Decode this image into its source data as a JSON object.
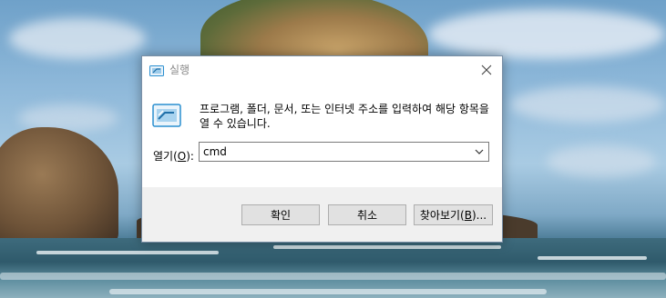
{
  "dialog": {
    "title": "실행",
    "close_icon": "close-icon",
    "description": "프로그램, 폴더, 문서, 또는 인터넷 주소를 입력하여 해당 항목을 열 수 있습니다.",
    "open_label_prefix": "열기(",
    "open_label_key": "O",
    "open_label_suffix": "):",
    "input_value": "cmd",
    "buttons": {
      "ok": "확인",
      "cancel": "취소",
      "browse_prefix": "찾아보기(",
      "browse_key": "B",
      "browse_suffix": ")..."
    }
  },
  "colors": {
    "dialog_bg": "#ffffff",
    "footer_bg": "#f0f0f0",
    "button_bg": "#e1e1e1",
    "icon_accent": "#2a8fd0"
  }
}
